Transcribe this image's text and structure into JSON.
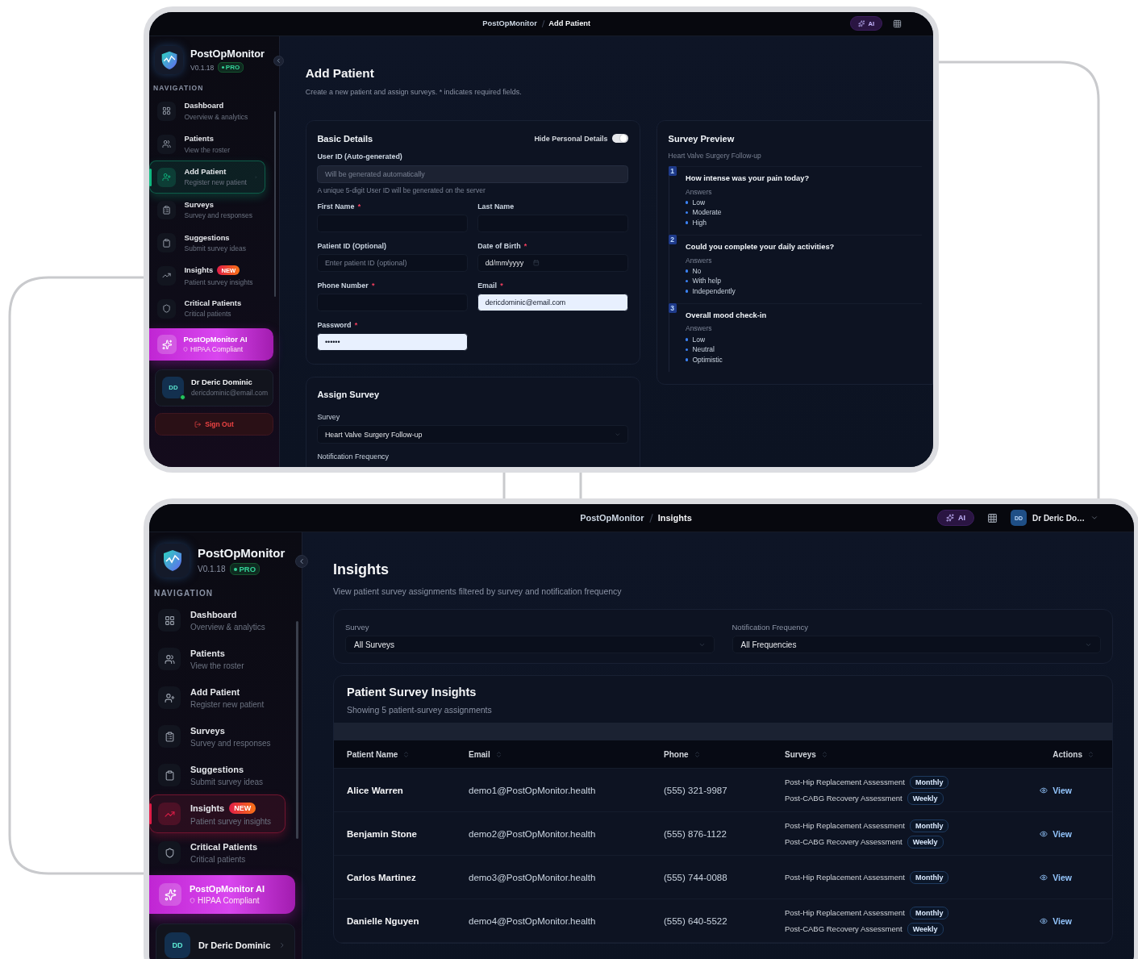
{
  "screens": [
    {
      "top_bar": {
        "breadcrumb": [
          "PostOpMonitor",
          "Add Patient"
        ],
        "ai_label": "AI"
      },
      "sidebar": {
        "app_name": "PostOpMonitor",
        "version": "V0.1.18",
        "plan": "PRO",
        "section": "NAVIGATION",
        "items": [
          {
            "title": "Dashboard",
            "subtitle": "Overview & analytics",
            "selected": false
          },
          {
            "title": "Patients",
            "subtitle": "View the roster",
            "selected": false
          },
          {
            "title": "Add Patient",
            "subtitle": "Register new patient",
            "selected": true,
            "color": "#10b981"
          },
          {
            "title": "Surveys",
            "subtitle": "Survey and responses",
            "selected": false
          },
          {
            "title": "Suggestions",
            "subtitle": "Submit survey ideas",
            "selected": false
          },
          {
            "title": "Insights",
            "subtitle": "Patient survey insights",
            "selected": false,
            "badge": "NEW"
          },
          {
            "title": "Critical Patients",
            "subtitle": "Critical patients",
            "selected": false
          }
        ],
        "ai_card": {
          "title": "PostOpMonitor AI",
          "subtitle": "HIPAA Compliant"
        },
        "user": {
          "initials": "DD",
          "name": "Dr Deric Dominic",
          "email": "dericdominic@email.com",
          "online": true
        },
        "sign_out": "Sign Out"
      },
      "page": {
        "kind": "add_patient",
        "title": "Add Patient",
        "subtitle": "Create a new patient and assign surveys. * indicates required fields.",
        "basic": {
          "title": "Basic Details",
          "toggle": {
            "label": "Hide Personal Details",
            "on": true
          },
          "user_id": {
            "label": "User ID (Auto-generated)",
            "placeholder": "Will be generated automatically",
            "disabled": true,
            "hint": "A unique 5-digit User ID will be generated on the server"
          },
          "fields": [
            {
              "kind": "text",
              "label": "First Name",
              "mark": "*"
            },
            {
              "kind": "text",
              "label": "Last Name"
            },
            {
              "kind": "text",
              "label": "Patient ID (Optional)",
              "placeholder": "Enter patient ID (optional)"
            },
            {
              "kind": "date",
              "label": "Date of Birth",
              "mark": "*",
              "value": "dd/mm/yyyy"
            },
            {
              "kind": "text",
              "label": "Phone Number",
              "mark": "*"
            },
            {
              "kind": "text",
              "label": "Email",
              "mark": "*",
              "value": "dericdominic@email.com",
              "autofilled": true
            },
            {
              "kind": "text",
              "label": "Password",
              "mark": "*",
              "value": "••••••",
              "autofilled": true
            }
          ]
        },
        "assign": {
          "title": "Assign Survey",
          "survey_label": "Survey",
          "survey_value": "Heart Valve Surgery Follow-up",
          "next_label": "Notification Frequency"
        },
        "preview": {
          "title": "Survey Preview",
          "subtitle": "Heart Valve Surgery Follow-up",
          "questions": [
            {
              "number": "1",
              "question": "How intense was your pain today?",
              "answers_label": "Answers",
              "answers": [
                "Low",
                "Moderate",
                "High"
              ]
            },
            {
              "number": "2",
              "question": "Could you complete your daily activities?",
              "answers_label": "Answers",
              "answers": [
                "No",
                "With help",
                "Independently"
              ]
            },
            {
              "number": "3",
              "question": "Overall mood check-in",
              "answers_label": "Answers",
              "answers": [
                "Low",
                "Neutral",
                "Optimistic"
              ]
            }
          ]
        }
      }
    },
    {
      "top_bar": {
        "breadcrumb": [
          "PostOpMonitor",
          "Insights"
        ],
        "ai_label": "AI",
        "user": {
          "initials": "DD",
          "name": "Dr Deric Do…"
        }
      },
      "sidebar": {
        "app_name": "PostOpMonitor",
        "version": "V0.1.18",
        "plan": "PRO",
        "section": "NAVIGATION",
        "items": [
          {
            "title": "Dashboard",
            "subtitle": "Overview & analytics",
            "selected": false
          },
          {
            "title": "Patients",
            "subtitle": "View the roster",
            "selected": false
          },
          {
            "title": "Add Patient",
            "subtitle": "Register new patient",
            "selected": false
          },
          {
            "title": "Surveys",
            "subtitle": "Survey and responses",
            "selected": false
          },
          {
            "title": "Suggestions",
            "subtitle": "Submit survey ideas",
            "selected": false
          },
          {
            "title": "Insights",
            "subtitle": "Patient survey insights",
            "selected": true,
            "badge": "NEW",
            "color": "#e11d48"
          },
          {
            "title": "Critical Patients",
            "subtitle": "Critical patients",
            "selected": false
          }
        ],
        "ai_card": {
          "title": "PostOpMonitor AI",
          "subtitle": "HIPAA Compliant"
        },
        "user": {
          "initials": "DD",
          "name": "Dr Deric Dominic"
        }
      },
      "page": {
        "kind": "insights",
        "title": "Insights",
        "subtitle": "View patient survey assignments filtered by survey and notification frequency",
        "filters": [
          {
            "label": "Survey",
            "value": "All Surveys"
          },
          {
            "label": "Notification Frequency",
            "value": "All Frequencies"
          }
        ],
        "table": {
          "title": "Patient Survey Insights",
          "subtitle": "Showing 5 patient-survey assignments",
          "columns": [
            "Patient Name",
            "Email",
            "Phone",
            "Surveys",
            "Actions"
          ],
          "rows": [
            {
              "name": "Alice Warren",
              "email": "demo1@PostOpMonitor.health",
              "phone": "(555) 321-9987",
              "surveys": [
                {
                  "name": "Post-Hip Replacement Assessment",
                  "frequency": "Monthly"
                },
                {
                  "name": "Post-CABG Recovery Assessment",
                  "frequency": "Weekly"
                }
              ],
              "action": "View"
            },
            {
              "name": "Benjamin Stone",
              "email": "demo2@PostOpMonitor.health",
              "phone": "(555) 876-1122",
              "surveys": [
                {
                  "name": "Post-Hip Replacement Assessment",
                  "frequency": "Monthly"
                },
                {
                  "name": "Post-CABG Recovery Assessment",
                  "frequency": "Weekly"
                }
              ],
              "action": "View"
            },
            {
              "name": "Carlos Martinez",
              "email": "demo3@PostOpMonitor.health",
              "phone": "(555) 744-0088",
              "surveys": [
                {
                  "name": "Post-Hip Replacement Assessment",
                  "frequency": "Monthly"
                }
              ],
              "action": "View"
            },
            {
              "name": "Danielle Nguyen",
              "email": "demo4@PostOpMonitor.health",
              "phone": "(555) 640-5522",
              "surveys": [
                {
                  "name": "Post-Hip Replacement Assessment",
                  "frequency": "Monthly"
                },
                {
                  "name": "Post-CABG Recovery Assessment",
                  "frequency": "Weekly"
                }
              ],
              "action": "View"
            }
          ]
        }
      }
    }
  ]
}
